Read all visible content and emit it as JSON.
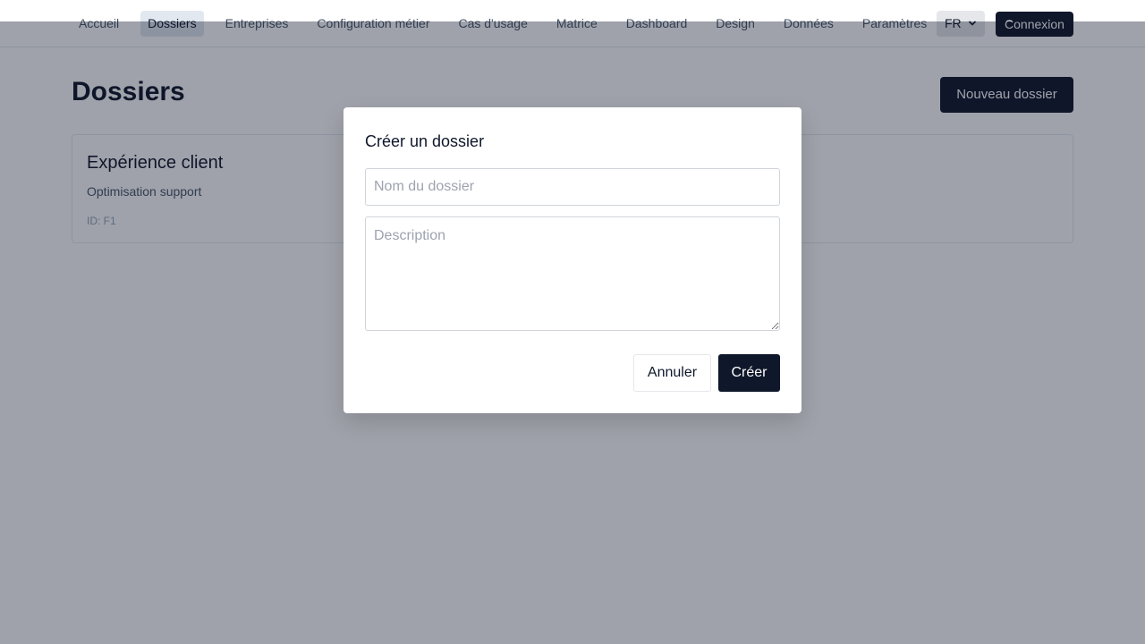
{
  "nav": {
    "items": [
      {
        "label": "Accueil",
        "active": false
      },
      {
        "label": "Dossiers",
        "active": true
      },
      {
        "label": "Entreprises",
        "active": false
      },
      {
        "label": "Configuration métier",
        "active": false
      },
      {
        "label": "Cas d'usage",
        "active": false
      },
      {
        "label": "Matrice",
        "active": false
      },
      {
        "label": "Dashboard",
        "active": false
      },
      {
        "label": "Design",
        "active": false
      },
      {
        "label": "Données",
        "active": false
      },
      {
        "label": "Paramètres",
        "active": false
      }
    ],
    "language": "FR",
    "language_icon": "chevron-down-icon",
    "login_label": "Connexion"
  },
  "page": {
    "title": "Dossiers",
    "new_button_label": "Nouveau dossier",
    "folders": [
      {
        "title": "Expérience client",
        "description": "Optimisation support",
        "id_text": "ID: F1"
      }
    ]
  },
  "modal": {
    "title": "Créer un dossier",
    "name_placeholder": "Nom du dossier",
    "name_value": "",
    "description_placeholder": "Description",
    "description_value": "",
    "cancel_label": "Annuler",
    "create_label": "Créer"
  },
  "colors": {
    "primary": "#0f172a",
    "overlay": "#0f172a",
    "nav_active_bg": "#e2e8f0",
    "muted_text": "#475569"
  }
}
